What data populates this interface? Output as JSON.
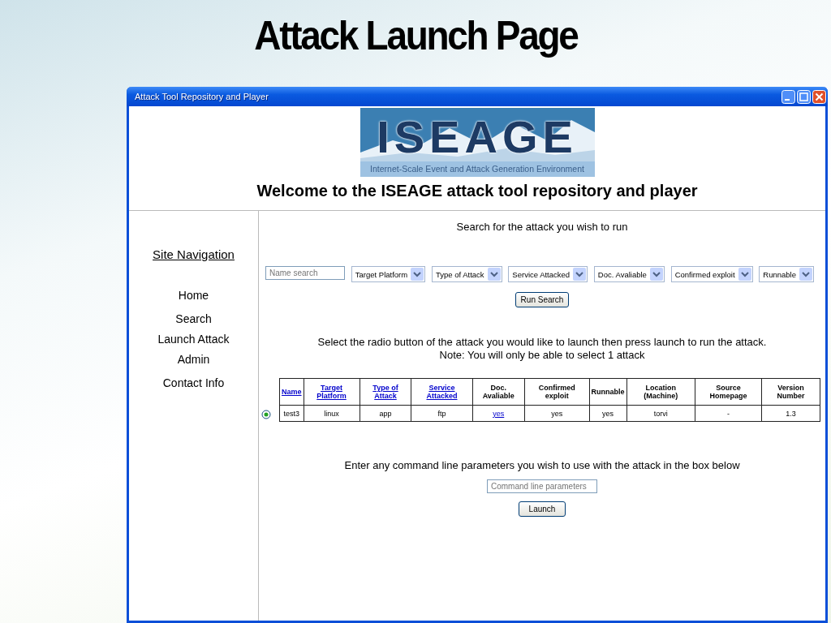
{
  "slide_title": "Attack Launch Page",
  "window": {
    "title": "Attack Tool Repository and Player"
  },
  "logo": {
    "title": "ISEAGE",
    "subtitle": "Internet-Scale Event and Attack Generation Environment"
  },
  "welcome": "Welcome to the ISEAGE attack tool repository and player",
  "sidebar": {
    "heading": "Site Navigation",
    "items": [
      {
        "label": "Home"
      },
      {
        "label": "Search"
      },
      {
        "label": "Launch Attack"
      },
      {
        "label": "Admin"
      },
      {
        "label": "Contact Info"
      }
    ]
  },
  "search": {
    "heading": "Search for the attack you wish to run",
    "name_field": {
      "placeholder": "Name search"
    },
    "filters": [
      {
        "label": "Target Platform"
      },
      {
        "label": "Type of Attack"
      },
      {
        "label": "Service Attacked"
      },
      {
        "label": "Doc. Avaliable"
      },
      {
        "label": "Confirmed exploit"
      },
      {
        "label": "Runnable"
      }
    ],
    "button": "Run Search"
  },
  "instructions": [
    "Select the radio button of the attack you would like to launch then press launch to run the attack.",
    "Note: You will only be able to select 1 attack"
  ],
  "table": {
    "columns": [
      {
        "label": "Name",
        "link": true
      },
      {
        "label": "Target Platform",
        "link": true
      },
      {
        "label": "Type of Attack",
        "link": true
      },
      {
        "label": "Service Attacked",
        "link": true
      },
      {
        "label": "Doc. Avaliable",
        "link": false
      },
      {
        "label": "Confirmed exploit",
        "link": false
      },
      {
        "label": "Runnable",
        "link": false
      },
      {
        "label": "Location (Machine)",
        "link": false
      },
      {
        "label": "Source Homepage",
        "link": false
      },
      {
        "label": "Version Number",
        "link": false
      }
    ],
    "rows": [
      {
        "selected": true,
        "cells": [
          {
            "text": "test3"
          },
          {
            "text": "linux"
          },
          {
            "text": "app"
          },
          {
            "text": "ftp"
          },
          {
            "text": "yes",
            "link": true
          },
          {
            "text": "yes"
          },
          {
            "text": "yes"
          },
          {
            "text": "torvi"
          },
          {
            "text": "-"
          },
          {
            "text": "1.3"
          }
        ]
      }
    ]
  },
  "launch": {
    "prompt": "Enter any command line parameters you wish to use with the attack in the box below",
    "field": {
      "placeholder": "Command line parameters"
    },
    "button": "Launch"
  }
}
